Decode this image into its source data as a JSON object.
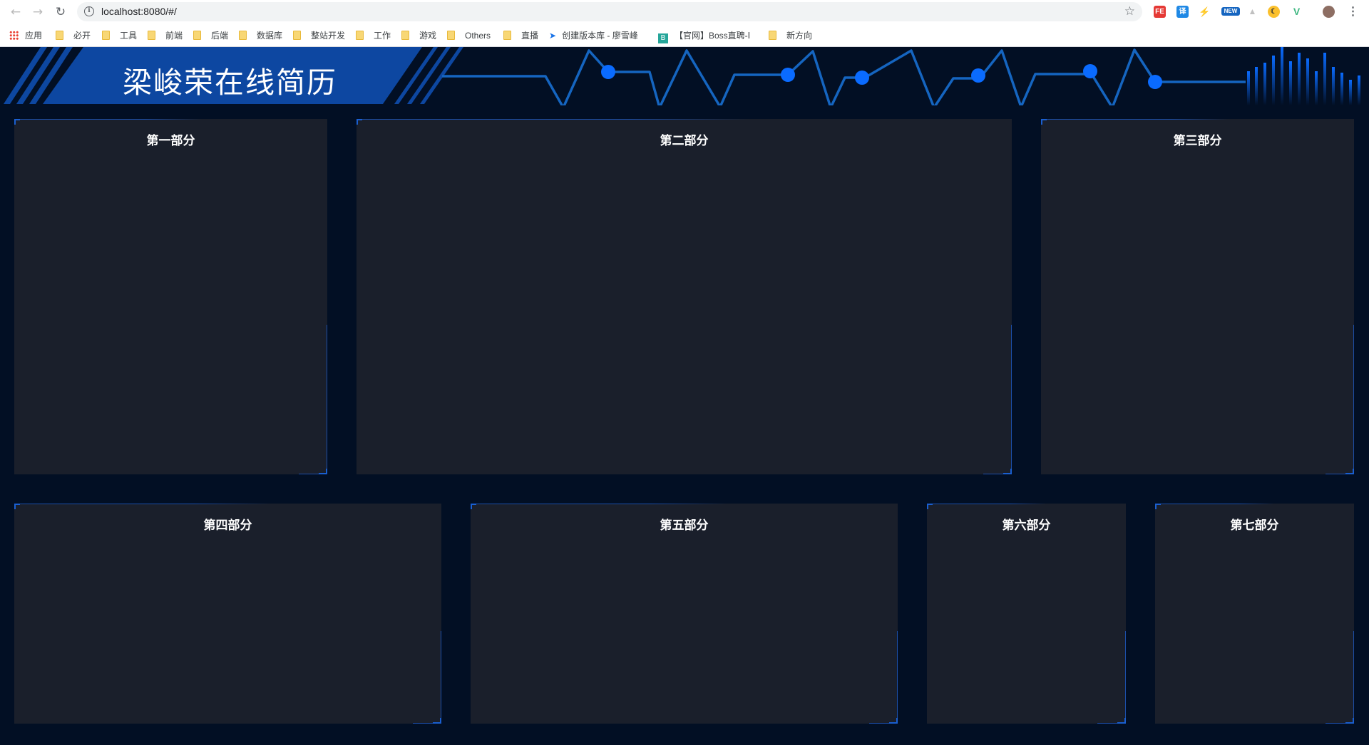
{
  "browser": {
    "url": "localhost:8080/#/",
    "bookmarks": [
      "应用",
      "必开",
      "工具",
      "前端",
      "后端",
      "数据库",
      "整站开发",
      "工作",
      "游戏",
      "Others",
      "直播",
      "创建版本库 - 廖雪峰",
      "【官网】Boss直聘-Ⅰ",
      "新方向"
    ],
    "extensions": [
      "FE",
      "译",
      "NEW"
    ]
  },
  "header": {
    "title": "梁峻荣在线简历",
    "accent_color": "#0a6bff",
    "banner_color": "#0d47a1"
  },
  "panels": [
    {
      "title": "第一部分"
    },
    {
      "title": "第二部分"
    },
    {
      "title": "第三部分"
    },
    {
      "title": "第四部分"
    },
    {
      "title": "第五部分"
    },
    {
      "title": "第六部分"
    },
    {
      "title": "第七部分"
    }
  ]
}
